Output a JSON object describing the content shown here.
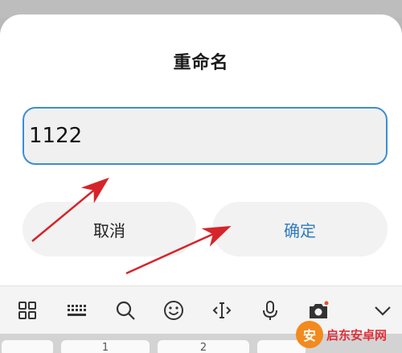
{
  "dialog": {
    "title": "重命名",
    "input_value": "1122",
    "cancel_label": "取消",
    "confirm_label": "确定"
  },
  "keyboard": {
    "toolbar_icons": [
      "grid-icon",
      "keyboard-icon",
      "search-icon",
      "emoji-icon",
      "cursor-icon",
      "microphone-icon",
      "camera-icon",
      "chevron-down-icon"
    ],
    "keys": [
      "1",
      "2"
    ]
  },
  "watermark": {
    "text": "启东安卓网",
    "logo_glyph": "安"
  },
  "colors": {
    "accent": "#2f7bbd",
    "input_border": "#3a8fd4",
    "annotation_arrow": "#d6242a"
  }
}
